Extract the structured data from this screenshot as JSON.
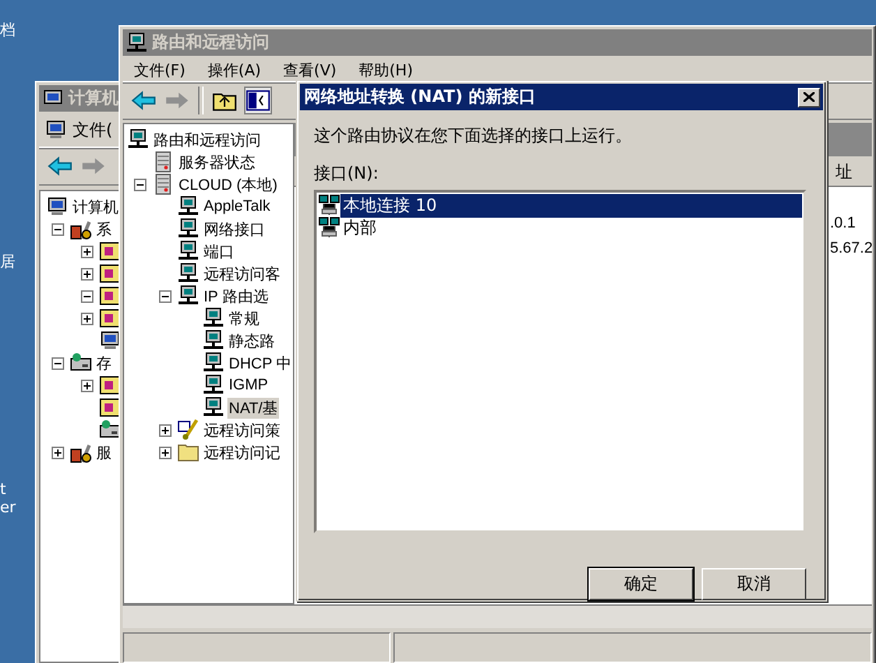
{
  "desktop": {
    "icon_labels": [
      "档",
      "居",
      "t",
      "er"
    ]
  },
  "computer_management": {
    "title": "计算机",
    "menu": [
      "文件("
    ],
    "tree": [
      {
        "label": "计算机",
        "kind": "computer",
        "children": [
          {
            "label": "系",
            "kind": "tools",
            "expanded": true,
            "children": [
              {
                "kind": "app",
                "expanded": false
              },
              {
                "kind": "app",
                "expanded": false
              },
              {
                "kind": "app",
                "expanded": true
              },
              {
                "kind": "app",
                "expanded": false
              },
              {
                "kind": "computer"
              }
            ]
          },
          {
            "label": "存",
            "kind": "disk",
            "expanded": true,
            "children": [
              {
                "kind": "app",
                "expanded": false
              },
              {
                "kind": "app"
              },
              {
                "kind": "disk"
              }
            ]
          },
          {
            "label": "服",
            "kind": "tools",
            "expanded": false
          }
        ]
      }
    ]
  },
  "routing": {
    "title": "路由和远程访问",
    "menu": [
      "文件(F)",
      "操作(A)",
      "查看(V)",
      "帮助(H)"
    ],
    "tree": [
      {
        "label": "路由和远程访问",
        "kind": "node",
        "selected": false,
        "children": [
          {
            "label": "服务器状态",
            "kind": "server",
            "selected": false
          },
          {
            "label": "CLOUD (本地)",
            "kind": "server",
            "selected": false,
            "expanded": true,
            "children": [
              {
                "label": "AppleTalk",
                "kind": "node",
                "selected": false
              },
              {
                "label": "网络接口",
                "kind": "node",
                "selected": false
              },
              {
                "label": "端口",
                "kind": "node",
                "selected": false
              },
              {
                "label": "远程访问客",
                "kind": "node",
                "selected": false
              },
              {
                "label": "IP 路由选",
                "kind": "node",
                "selected": false,
                "expanded": true,
                "children": [
                  {
                    "label": "常规",
                    "kind": "node",
                    "selected": false
                  },
                  {
                    "label": "静态路",
                    "kind": "node",
                    "selected": false
                  },
                  {
                    "label": "DHCP 中",
                    "kind": "node",
                    "selected": false
                  },
                  {
                    "label": "IGMP",
                    "kind": "node",
                    "selected": false
                  },
                  {
                    "label": "NAT/基",
                    "kind": "node",
                    "selected": true
                  }
                ]
              },
              {
                "label": "远程访问策",
                "kind": "policy",
                "selected": false,
                "expanded": false
              },
              {
                "label": "远程访问记",
                "kind": "folder",
                "selected": false,
                "expanded": false
              }
            ]
          }
        ]
      }
    ],
    "details": {
      "column": "址",
      "values": [
        ".0.1",
        "5.67.2"
      ]
    }
  },
  "dialog": {
    "title": "网络地址转换 (NAT) 的新接口",
    "message": "这个路由协议在您下面选择的接口上运行。",
    "list_label": "接口(N):",
    "interfaces": [
      {
        "label": "本地连接 10",
        "selected": true
      },
      {
        "label": "内部",
        "selected": false
      }
    ],
    "buttons": [
      {
        "label": "确定",
        "default": true
      },
      {
        "label": "取消",
        "default": false
      }
    ]
  }
}
